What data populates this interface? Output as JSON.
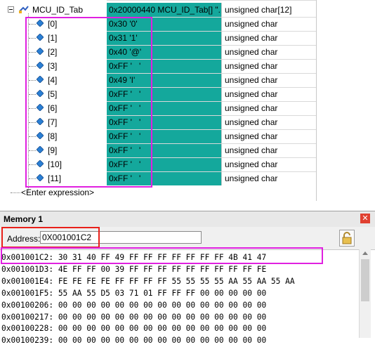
{
  "watch": {
    "root": {
      "name": "MCU_ID_Tab",
      "value": "0x20000440 MCU_ID_Tab[] \"...",
      "type": "unsigned char[12]"
    },
    "elements": [
      {
        "name": "[0]",
        "value": "0x30 '0'",
        "type": "unsigned char"
      },
      {
        "name": "[1]",
        "value": "0x31 '1'",
        "type": "unsigned char"
      },
      {
        "name": "[2]",
        "value": "0x40 '@'",
        "type": "unsigned char"
      },
      {
        "name": "[3]",
        "value": "0xFF '   '",
        "type": "unsigned char"
      },
      {
        "name": "[4]",
        "value": "0x49 'I'",
        "type": "unsigned char"
      },
      {
        "name": "[5]",
        "value": "0xFF '   '",
        "type": "unsigned char"
      },
      {
        "name": "[6]",
        "value": "0xFF '   '",
        "type": "unsigned char"
      },
      {
        "name": "[7]",
        "value": "0xFF '   '",
        "type": "unsigned char"
      },
      {
        "name": "[8]",
        "value": "0xFF '   '",
        "type": "unsigned char"
      },
      {
        "name": "[9]",
        "value": "0xFF '   '",
        "type": "unsigned char"
      },
      {
        "name": "[10]",
        "value": "0xFF '   '",
        "type": "unsigned char"
      },
      {
        "name": "[11]",
        "value": "0xFF '   '",
        "type": "unsigned char"
      }
    ],
    "enter_expression": "<Enter expression>"
  },
  "memory": {
    "title": "Memory 1",
    "address_label": "Address:",
    "address_value": "0X001001C2",
    "lines": [
      "0x001001C2: 30 31 40 FF 49 FF FF FF FF FF FF FF 4B 41 47",
      "0x001001D3: 4E FF FF 00 39 FF FF FF FF FF FF FF FF FF FE",
      "0x001001E4: FE FE FE FE FF FF FF FF 55 55 55 55 AA 55 AA 55 AA",
      "0x001001F5: 55 AA 55 D5 03 71 01 FF FF FF 00 00 00 00 00",
      "0x00100206: 00 00 00 00 00 00 00 00 00 00 00 00 00 00 00",
      "0x00100217: 00 00 00 00 00 00 00 00 00 00 00 00 00 00 00",
      "0x00100228: 00 00 00 00 00 00 00 00 00 00 00 00 00 00 00",
      "0x00100239: 00 00 00 00 00 00 00 00 00 00 00 00 00 00 00"
    ]
  },
  "colors": {
    "value_bg": "#14a89c",
    "highlight_magenta": "#e020e0",
    "highlight_red": "#e8201a"
  }
}
